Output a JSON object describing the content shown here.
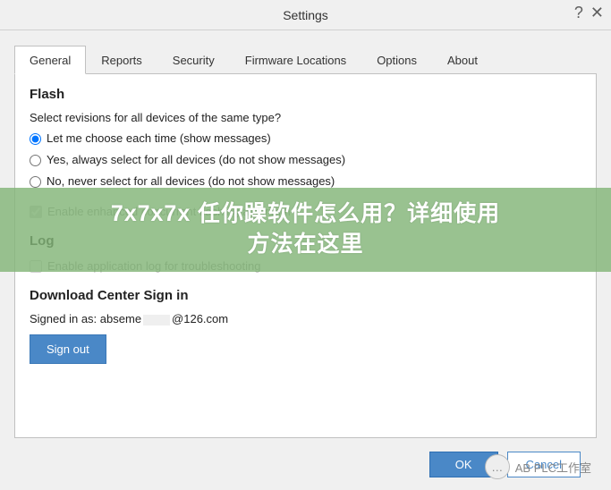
{
  "window": {
    "title": "Settings"
  },
  "tabs": [
    "General",
    "Reports",
    "Security",
    "Firmware Locations",
    "Options",
    "About"
  ],
  "flash": {
    "heading": "Flash",
    "question": "Select revisions for all devices of the same type?",
    "options": [
      "Let me choose each time (show messages)",
      "Yes, always select for all devices (do not show messages)",
      "No, never select for all devices (do not show messages)"
    ],
    "enhanced": "Enable enhanced concurrent flashing algorithm"
  },
  "log": {
    "heading": "Log",
    "enable": "Enable application log for troubleshooting"
  },
  "dc": {
    "heading": "Download Center Sign in",
    "signed_prefix": "Signed in as:",
    "user": "abseme",
    "domain": "@126.com",
    "signout": "Sign out"
  },
  "footer": {
    "ok": "OK",
    "cancel": "Cancel"
  },
  "overlay": {
    "line1": "7x7x7x 任你躁软件怎么用？详细使用",
    "line2": "方法在这里"
  },
  "watermark": {
    "text": "AB PLC工作室"
  }
}
